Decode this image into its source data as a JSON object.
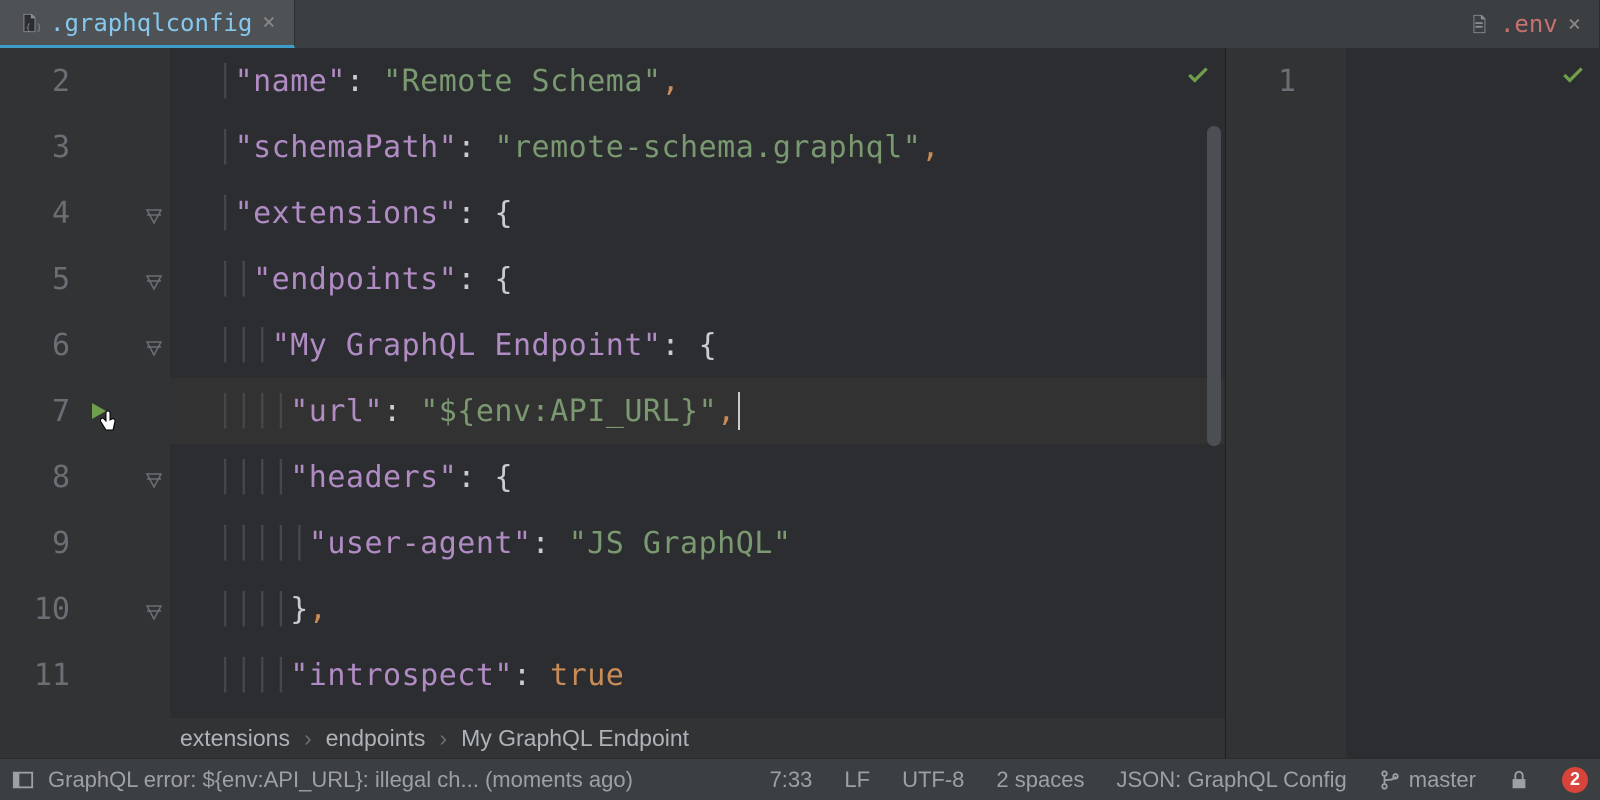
{
  "tabs": {
    "left": {
      "name": ".graphqlconfig"
    },
    "right": {
      "name": ".env"
    }
  },
  "left_editor": {
    "lines": [
      {
        "n": "2",
        "fold": false,
        "ind": 1,
        "k": "name",
        "sep": ": ",
        "v": "\"Remote Schema\"",
        "vt": "str",
        "tc": ","
      },
      {
        "n": "3",
        "fold": false,
        "ind": 1,
        "k": "schemaPath",
        "sep": ": ",
        "v": "\"remote-schema.graphql\"",
        "vt": "str",
        "tc": ","
      },
      {
        "n": "4",
        "fold": true,
        "ind": 1,
        "k": "extensions",
        "sep": ": ",
        "v": "{",
        "vt": "brace",
        "tc": ""
      },
      {
        "n": "5",
        "fold": true,
        "ind": 2,
        "k": "endpoints",
        "sep": ": ",
        "v": "{",
        "vt": "brace",
        "tc": ""
      },
      {
        "n": "6",
        "fold": true,
        "ind": 3,
        "k": "My GraphQL Endpoint",
        "sep": ": ",
        "v": "{",
        "vt": "brace",
        "tc": ""
      },
      {
        "n": "7",
        "fold": false,
        "hl": true,
        "run": true,
        "ind": 4,
        "k": "url",
        "sep": ": ",
        "v": "\"${env:API_URL}\"",
        "vt": "str",
        "tc": ",",
        "caret": true
      },
      {
        "n": "8",
        "fold": true,
        "ind": 4,
        "k": "headers",
        "sep": ": ",
        "v": "{",
        "vt": "brace",
        "tc": ""
      },
      {
        "n": "9",
        "fold": false,
        "ind": 5,
        "k": "user-agent",
        "sep": ": ",
        "v": "\"JS GraphQL\"",
        "vt": "str",
        "tc": ""
      },
      {
        "n": "10",
        "fold": true,
        "ind": 4,
        "k": "",
        "sep": "",
        "v": "}",
        "vt": "brace",
        "tc": ","
      },
      {
        "n": "11",
        "fold": false,
        "ind": 4,
        "k": "introspect",
        "sep": ": ",
        "v": "true",
        "vt": "bool",
        "tc": ""
      }
    ]
  },
  "right_editor": {
    "lines": [
      {
        "n": "1"
      }
    ]
  },
  "breadcrumb": [
    "extensions",
    "endpoints",
    "My GraphQL Endpoint"
  ],
  "status": {
    "error_msg": "GraphQL error: ${env:API_URL}: illegal ch... (moments ago)",
    "pos": "7:33",
    "eol": "LF",
    "enc": "UTF-8",
    "indent": "2 spaces",
    "lang": "JSON: GraphQL Config",
    "branch": "master",
    "error_count": "2"
  }
}
